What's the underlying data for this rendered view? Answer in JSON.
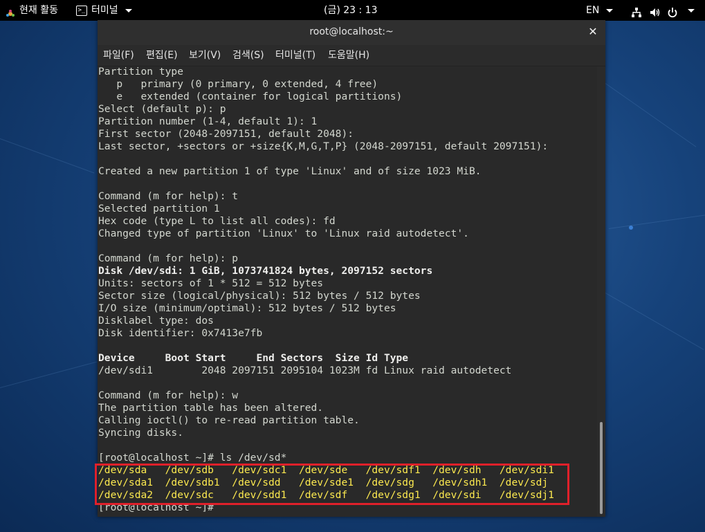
{
  "topbar": {
    "activities_label": "현재 활동",
    "app_label": "터미널",
    "clock": "(금) 23 : 13",
    "lang": "EN"
  },
  "window": {
    "title": "root@localhost:~",
    "close_glyph": "✕",
    "menu": [
      "파일(F)",
      "편집(E)",
      "보기(V)",
      "검색(S)",
      "터미널(T)",
      "도움말(H)"
    ]
  },
  "terminal": {
    "lines": [
      {
        "text": "Partition type",
        "style": ""
      },
      {
        "text": "   p   primary (0 primary, 0 extended, 4 free)",
        "style": ""
      },
      {
        "text": "   e   extended (container for logical partitions)",
        "style": ""
      },
      {
        "text": "Select (default p): p",
        "style": ""
      },
      {
        "text": "Partition number (1-4, default 1): 1",
        "style": ""
      },
      {
        "text": "First sector (2048-2097151, default 2048):",
        "style": ""
      },
      {
        "text": "Last sector, +sectors or +size{K,M,G,T,P} (2048-2097151, default 2097151):",
        "style": ""
      },
      {
        "text": "",
        "style": ""
      },
      {
        "text": "Created a new partition 1 of type 'Linux' and of size 1023 MiB.",
        "style": ""
      },
      {
        "text": "",
        "style": ""
      },
      {
        "text": "Command (m for help): t",
        "style": ""
      },
      {
        "text": "Selected partition 1",
        "style": ""
      },
      {
        "text": "Hex code (type L to list all codes): fd",
        "style": ""
      },
      {
        "text": "Changed type of partition 'Linux' to 'Linux raid autodetect'.",
        "style": ""
      },
      {
        "text": "",
        "style": ""
      },
      {
        "text": "Command (m for help): p",
        "style": ""
      },
      {
        "text": "Disk /dev/sdi: 1 GiB, 1073741824 bytes, 2097152 sectors",
        "style": "bold"
      },
      {
        "text": "Units: sectors of 1 * 512 = 512 bytes",
        "style": ""
      },
      {
        "text": "Sector size (logical/physical): 512 bytes / 512 bytes",
        "style": ""
      },
      {
        "text": "I/O size (minimum/optimal): 512 bytes / 512 bytes",
        "style": ""
      },
      {
        "text": "Disklabel type: dos",
        "style": ""
      },
      {
        "text": "Disk identifier: 0x7413e7fb",
        "style": ""
      },
      {
        "text": "",
        "style": ""
      },
      {
        "text": "Device     Boot Start     End Sectors  Size Id Type",
        "style": "bold"
      },
      {
        "text": "/dev/sdi1        2048 2097151 2095104 1023M fd Linux raid autodetect",
        "style": ""
      },
      {
        "text": "",
        "style": ""
      },
      {
        "text": "Command (m for help): w",
        "style": ""
      },
      {
        "text": "The partition table has been altered.",
        "style": ""
      },
      {
        "text": "Calling ioctl() to re-read partition table.",
        "style": ""
      },
      {
        "text": "Syncing disks.",
        "style": ""
      },
      {
        "text": "",
        "style": ""
      },
      {
        "text": "[root@localhost ~]# ls /dev/sd*",
        "style": ""
      },
      {
        "text": "/dev/sda   /dev/sdb   /dev/sdc1  /dev/sde   /dev/sdf1  /dev/sdh   /dev/sdi1",
        "style": "yellow"
      },
      {
        "text": "/dev/sda1  /dev/sdb1  /dev/sdd   /dev/sde1  /dev/sdg   /dev/sdh1  /dev/sdj",
        "style": "yellow"
      },
      {
        "text": "/dev/sda2  /dev/sdc   /dev/sdd1  /dev/sdf   /dev/sdg1  /dev/sdi   /dev/sdj1",
        "style": "yellow"
      },
      {
        "text": "[root@localhost ~]# ",
        "style": ""
      }
    ]
  },
  "colors": {
    "terminal_bg": "#292929",
    "terminal_fg": "#d3d7cf",
    "device_yellow": "#fce94f",
    "highlight_red": "#e0202a",
    "desktop_blue": "#16427a"
  },
  "icons": [
    "activities-icon",
    "terminal-icon",
    "network-icon",
    "volume-icon",
    "power-icon"
  ]
}
